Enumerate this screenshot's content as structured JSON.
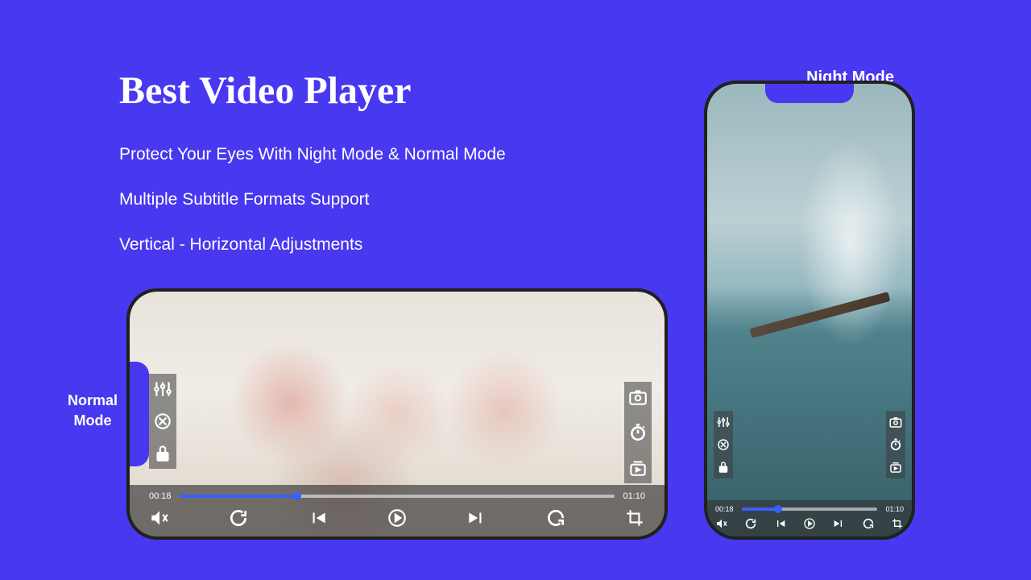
{
  "title": "Best Video Player",
  "features": [
    "Protect Your Eyes With Night Mode & Normal Mode",
    "Multiple Subtitle Formats Support",
    "Vertical - Horizontal Adjustments"
  ],
  "labels": {
    "normal_mode_line1": "Normal",
    "normal_mode_line2": "Mode",
    "night_mode": "Night Mode"
  },
  "player": {
    "current_time": "00:18",
    "total_time": "01:10",
    "progress_percent": 27
  }
}
